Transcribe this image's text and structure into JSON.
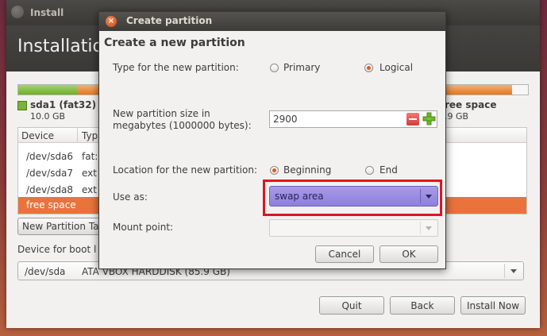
{
  "main_window": {
    "title": "Install",
    "header_title": "Installatio",
    "legend": {
      "sda1_label": "sda1 (fat32)",
      "sda1_size": "10.0 GB",
      "free_label": "ree space",
      "free_size": ".9 GB"
    },
    "table": {
      "headers": [
        "Device",
        "Typ"
      ],
      "rows": [
        {
          "device": "/dev/sda6",
          "type": "fat:"
        },
        {
          "device": "/dev/sda7",
          "type": "ext"
        },
        {
          "device": "/dev/sda8",
          "type": "ext"
        },
        {
          "device": "free space",
          "type": ""
        }
      ]
    },
    "new_partition_table_label": "New Partition Ta",
    "boot_label": "Device for boot l",
    "boot_device": "/dev/sda",
    "boot_disk": "ATA VBOX HARDDISK (85.9 GB)",
    "buttons": {
      "quit": "Quit",
      "back": "Back",
      "install_now": "Install Now"
    }
  },
  "dialog": {
    "title": "Create partition",
    "heading": "Create a new partition",
    "type_label": "Type for the new partition:",
    "type_options": {
      "primary": "Primary",
      "logical": "Logical",
      "selected": "Logical"
    },
    "size_label_line1": "New partition size in",
    "size_label_line2": "megabytes (1000000 bytes):",
    "size_value": "2900",
    "location_label": "Location for the new partition:",
    "location_options": {
      "beginning": "Beginning",
      "end": "End",
      "selected": "Beginning"
    },
    "use_as_label": "Use as:",
    "use_as_value": "swap area",
    "mount_label": "Mount point:",
    "mount_value": "",
    "buttons": {
      "cancel": "Cancel",
      "ok": "OK"
    }
  },
  "colors": {
    "accent": "#e05a1f",
    "highlight_border": "#e0141f",
    "selected_combo": "#9a8ce0",
    "free_space_row": "#e8743b"
  }
}
